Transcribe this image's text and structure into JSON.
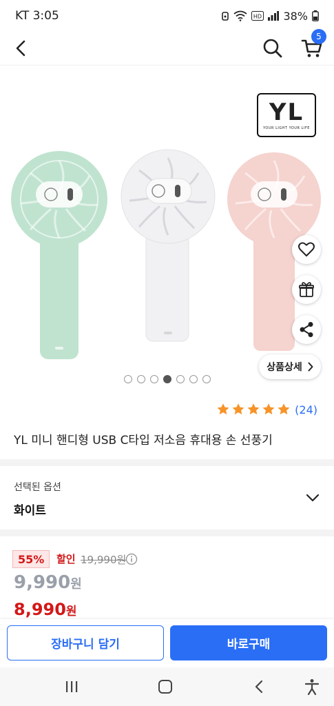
{
  "status_bar": {
    "carrier_time": "KT 3:05",
    "battery": "38%"
  },
  "header": {
    "cart_count": "5"
  },
  "gallery": {
    "brand_mark": "YL",
    "brand_tagline": "YOUR LIGHT YOUR LIFE",
    "detail_button": "상품상세",
    "slide_count": 7,
    "active_slide": 4,
    "fan_colors": [
      "#bfe3cf",
      "#f1f1f3",
      "#f5d3cf"
    ]
  },
  "rating": {
    "stars": 5,
    "count": "(24)"
  },
  "product": {
    "title": "YL 미니 핸디형 USB C타입 저소음 휴대용 손 선풍기"
  },
  "option": {
    "label": "선택된 옵션",
    "value": "화이트"
  },
  "price": {
    "discount_rate": "55%",
    "discount_word": "할인",
    "original": "19,990원",
    "sale_amount": "9,990",
    "final_amount": "8,990",
    "currency": "원"
  },
  "actions": {
    "add_to_cart": "장바구니 담기",
    "buy_now": "바로구매"
  },
  "colors": {
    "accent": "#2a6ef6",
    "discount": "#d31818",
    "star": "#f6942a"
  }
}
